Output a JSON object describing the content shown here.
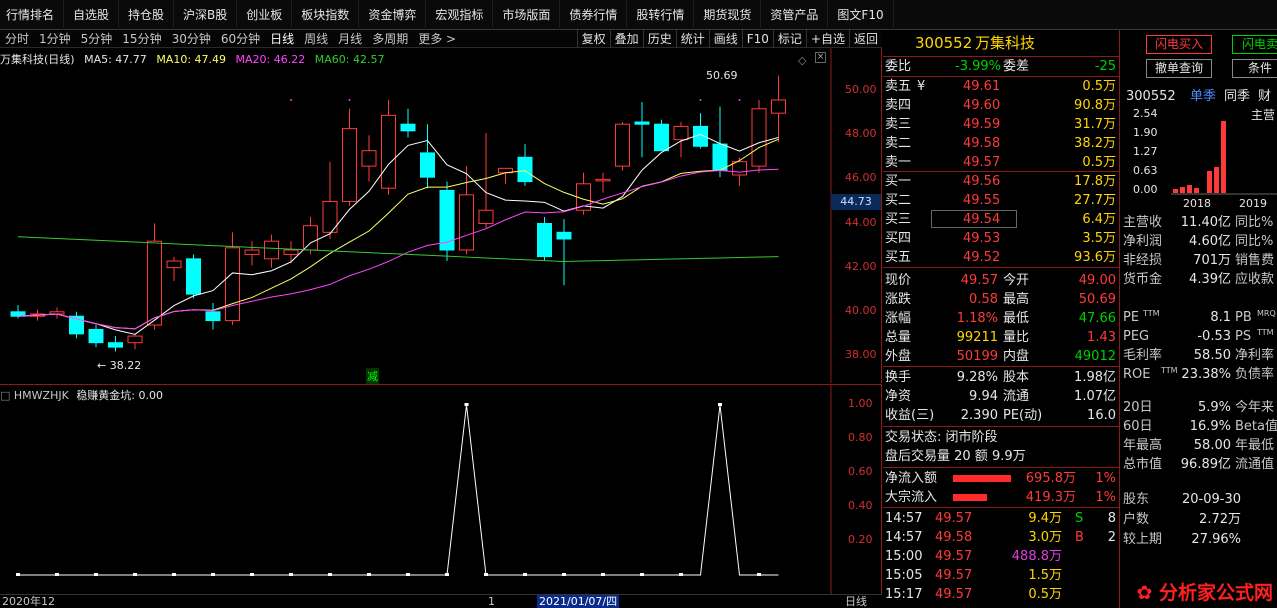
{
  "menu": [
    "行情排名",
    "自选股",
    "持仓股",
    "沪深B股",
    "创业板",
    "板块指数",
    "资金博弈",
    "宏观指标",
    "市场版面",
    "债券行情",
    "股转行情",
    "期货现货",
    "资管产品",
    "图文F10"
  ],
  "periods": [
    "分时",
    "1分钟",
    "5分钟",
    "15分钟",
    "30分钟",
    "60分钟",
    "日线",
    "周线",
    "月线",
    "多周期",
    "更多 >"
  ],
  "active_period": "日线",
  "tools": [
    "复权",
    "叠加",
    "历史",
    "统计",
    "画线",
    "F10",
    "标记",
    "+自选",
    "返回"
  ],
  "legend": {
    "title": "万集科技(日线)",
    "ma5": "MA5: 47.77",
    "ma10": "MA10: 47.49",
    "ma20": "MA20: 46.22",
    "ma60": "MA60: 42.57"
  },
  "colors": {
    "up": "#ff3a3a",
    "down": "#00ffff",
    "ma5": "#ffffff",
    "ma10": "#ffff66",
    "ma20": "#ff44ff",
    "ma60": "#33cc33"
  },
  "main_axis": [
    "50.00",
    "48.00",
    "46.00",
    "44.00",
    "42.00",
    "40.00",
    "38.00"
  ],
  "current_price_tag": "44.73",
  "high_label": "50.69",
  "low_label": "38.22",
  "reduce_marker": "减",
  "sub_legend": {
    "name": "HMWZHJK",
    "label": "稳赚黄金坑: 0.00"
  },
  "sub_axis": [
    "1.00",
    "0.80",
    "0.60",
    "0.40",
    "0.20"
  ],
  "time_axis": {
    "left": "2020年12",
    "mid_mark": "1",
    "cursor_date": "2021/01/07/四",
    "right": "日线"
  },
  "quote": {
    "code": "300552",
    "name": "万集科技",
    "weibi_label": "委比",
    "weibi_value": "-3.99%",
    "weicha_label": "委差",
    "weicha_value": "-25",
    "asks": [
      {
        "label": "卖五",
        "price": "49.61",
        "vol": "0.5万",
        "mark": "¥"
      },
      {
        "label": "卖四",
        "price": "49.60",
        "vol": "90.8万",
        "mark": ""
      },
      {
        "label": "卖三",
        "price": "49.59",
        "vol": "31.7万",
        "mark": ""
      },
      {
        "label": "卖二",
        "price": "49.58",
        "vol": "38.2万",
        "mark": ""
      },
      {
        "label": "卖一",
        "price": "49.57",
        "vol": "0.5万",
        "mark": ""
      }
    ],
    "bids": [
      {
        "label": "买一",
        "price": "49.56",
        "vol": "17.8万"
      },
      {
        "label": "买二",
        "price": "49.55",
        "vol": "27.7万"
      },
      {
        "label": "买三",
        "price": "49.54",
        "vol": "6.4万"
      },
      {
        "label": "买四",
        "price": "49.53",
        "vol": "3.5万"
      },
      {
        "label": "买五",
        "price": "49.52",
        "vol": "93.6万"
      }
    ],
    "stats": [
      {
        "l1": "现价",
        "v1": "49.57",
        "c1": "red",
        "l2": "今开",
        "v2": "49.00",
        "c2": "red"
      },
      {
        "l1": "涨跌",
        "v1": "0.58",
        "c1": "red",
        "l2": "最高",
        "v2": "50.69",
        "c2": "red"
      },
      {
        "l1": "涨幅",
        "v1": "1.18%",
        "c1": "red",
        "l2": "最低",
        "v2": "47.66",
        "c2": "green"
      },
      {
        "l1": "总量",
        "v1": "99211",
        "c1": "yellow",
        "l2": "量比",
        "v2": "1.43",
        "c2": "red"
      },
      {
        "l1": "外盘",
        "v1": "50199",
        "c1": "red",
        "l2": "内盘",
        "v2": "49012",
        "c2": "green"
      }
    ],
    "stats2": [
      {
        "l1": "换手",
        "v1": "9.28%",
        "l2": "股本",
        "v2": "1.98亿"
      },
      {
        "l1": "净资",
        "v1": "9.94",
        "l2": "流通",
        "v2": "1.07亿"
      },
      {
        "l1": "收益(三)",
        "v1": "2.390",
        "l2": "PE(动)",
        "v2": "16.0"
      }
    ],
    "trade_status": "交易状态: 闭市阶段",
    "after_hours": "盘后交易量 20 额 9.9万",
    "flows": [
      {
        "label": "净流入额",
        "value": "695.8万",
        "pct": "1%"
      },
      {
        "label": "大宗流入",
        "value": "419.3万",
        "pct": "1%"
      }
    ],
    "ticks": [
      {
        "time": "14:57",
        "price": "49.57",
        "vol": "9.4万",
        "side": "S",
        "n": "8"
      },
      {
        "time": "14:57",
        "price": "49.58",
        "vol": "3.0万",
        "side": "B",
        "n": "2"
      },
      {
        "time": "15:00",
        "price": "49.57",
        "vol": "488.8万",
        "side": "",
        "n": ""
      },
      {
        "time": "15:05",
        "price": "49.57",
        "vol": "1.5万",
        "side": "",
        "n": ""
      },
      {
        "time": "15:17",
        "price": "49.57",
        "vol": "0.5万",
        "side": "",
        "n": ""
      }
    ]
  },
  "right": {
    "buy_button": "闪电买入",
    "sell_button": "闪电卖",
    "cancel_button": "撤单查询",
    "cond_button": "条件",
    "code": "300552",
    "tabs": [
      "单季",
      "同季",
      "财"
    ],
    "chart_axis": [
      "2.54",
      "1.90",
      "1.27",
      "0.63",
      "0.00"
    ],
    "chart_years": [
      "2018",
      "2019"
    ],
    "chart_title": "主营",
    "fin": [
      {
        "l1": "主营收",
        "v1": "11.40亿",
        "l2": "同比%"
      },
      {
        "l1": "净利润",
        "v1": "4.60亿",
        "l2": "同比%"
      },
      {
        "l1": "非经损",
        "v1": "701万",
        "l2": "销售费"
      },
      {
        "l1": "货币金",
        "v1": "4.39亿",
        "l2": "应收款"
      }
    ],
    "val": [
      {
        "l1": "PE",
        "sup1": "TTM",
        "v1": "8.1",
        "l2": "PB",
        "sup2": "MRQ"
      },
      {
        "l1": "PEG",
        "sup1": "",
        "v1": "-0.53",
        "l2": "PS",
        "sup2": "TTM"
      },
      {
        "l1": "毛利率",
        "sup1": "",
        "v1": "58.50",
        "l2": "净利率",
        "sup2": ""
      },
      {
        "l1": "ROE",
        "sup1": "TTM",
        "v1": "23.38%",
        "l2": "负债率",
        "sup2": ""
      }
    ],
    "perf": [
      {
        "l1": "20日",
        "v1": "5.9%",
        "l2": "今年来"
      },
      {
        "l1": "60日",
        "v1": "16.9%",
        "l2": "Beta值"
      },
      {
        "l1": "年最高",
        "v1": "58.00",
        "l2": "年最低"
      },
      {
        "l1": "总市值",
        "v1": "96.89亿",
        "l2": "流通值"
      }
    ],
    "holders": [
      {
        "l": "股东",
        "v": "20-09-30"
      },
      {
        "l": "户数",
        "v": "2.72万"
      },
      {
        "l": "较上期",
        "v": "27.96%"
      }
    ]
  },
  "chart_data": {
    "type": "candlestick",
    "candles": [
      {
        "o": 40.0,
        "h": 40.3,
        "l": 39.7,
        "c": 39.8
      },
      {
        "o": 39.8,
        "h": 40.1,
        "l": 39.6,
        "c": 39.9
      },
      {
        "o": 39.9,
        "h": 40.2,
        "l": 39.7,
        "c": 40.0
      },
      {
        "o": 39.8,
        "h": 40.0,
        "l": 38.8,
        "c": 39.0
      },
      {
        "o": 39.2,
        "h": 39.4,
        "l": 38.4,
        "c": 38.6
      },
      {
        "o": 38.6,
        "h": 38.9,
        "l": 38.2,
        "c": 38.4
      },
      {
        "o": 38.6,
        "h": 39.0,
        "l": 38.3,
        "c": 38.9
      },
      {
        "o": 39.4,
        "h": 44.0,
        "l": 39.2,
        "c": 43.2
      },
      {
        "o": 42.0,
        "h": 42.5,
        "l": 41.4,
        "c": 42.3
      },
      {
        "o": 42.4,
        "h": 42.6,
        "l": 40.6,
        "c": 40.8
      },
      {
        "o": 40.0,
        "h": 40.4,
        "l": 39.2,
        "c": 39.6
      },
      {
        "o": 39.6,
        "h": 43.6,
        "l": 39.4,
        "c": 42.9
      },
      {
        "o": 42.6,
        "h": 43.2,
        "l": 42.1,
        "c": 42.8
      },
      {
        "o": 42.4,
        "h": 43.5,
        "l": 42.0,
        "c": 43.2
      },
      {
        "o": 42.6,
        "h": 43.2,
        "l": 42.2,
        "c": 42.8
      },
      {
        "o": 42.8,
        "h": 44.3,
        "l": 42.6,
        "c": 43.9
      },
      {
        "o": 43.6,
        "h": 46.8,
        "l": 43.3,
        "c": 45.0
      },
      {
        "o": 45.0,
        "h": 49.2,
        "l": 44.8,
        "c": 48.3
      },
      {
        "o": 46.6,
        "h": 48.0,
        "l": 45.9,
        "c": 47.3
      },
      {
        "o": 45.6,
        "h": 49.6,
        "l": 45.3,
        "c": 48.9
      },
      {
        "o": 48.5,
        "h": 49.2,
        "l": 47.9,
        "c": 48.2
      },
      {
        "o": 47.2,
        "h": 48.5,
        "l": 45.6,
        "c": 46.1
      },
      {
        "o": 45.5,
        "h": 45.9,
        "l": 42.3,
        "c": 42.8
      },
      {
        "o": 42.8,
        "h": 46.6,
        "l": 42.6,
        "c": 45.3
      },
      {
        "o": 44.0,
        "h": 48.1,
        "l": 43.8,
        "c": 44.6
      },
      {
        "o": 46.3,
        "h": 46.5,
        "l": 45.8,
        "c": 46.5
      },
      {
        "o": 47.0,
        "h": 47.6,
        "l": 45.7,
        "c": 45.9
      },
      {
        "o": 44.0,
        "h": 44.3,
        "l": 42.3,
        "c": 42.5
      },
      {
        "o": 43.6,
        "h": 44.2,
        "l": 41.2,
        "c": 43.3
      },
      {
        "o": 44.6,
        "h": 46.3,
        "l": 44.4,
        "c": 45.8
      },
      {
        "o": 46.0,
        "h": 46.3,
        "l": 45.4,
        "c": 46.0
      },
      {
        "o": 46.6,
        "h": 48.6,
        "l": 46.4,
        "c": 48.5
      },
      {
        "o": 48.6,
        "h": 49.5,
        "l": 47.0,
        "c": 48.5
      },
      {
        "o": 48.5,
        "h": 48.7,
        "l": 47.5,
        "c": 47.3
      },
      {
        "o": 47.8,
        "h": 48.6,
        "l": 47.0,
        "c": 48.4
      },
      {
        "o": 48.4,
        "h": 49.0,
        "l": 47.4,
        "c": 47.5
      },
      {
        "o": 47.6,
        "h": 49.3,
        "l": 46.1,
        "c": 46.4
      },
      {
        "o": 46.2,
        "h": 47.0,
        "l": 45.7,
        "c": 46.8
      },
      {
        "o": 46.6,
        "h": 49.6,
        "l": 46.3,
        "c": 49.2
      },
      {
        "o": 49.0,
        "h": 50.7,
        "l": 47.7,
        "c": 49.6
      }
    ],
    "indicator": [
      0,
      0,
      0,
      0,
      0,
      0,
      0,
      0,
      0,
      0,
      0,
      0,
      0,
      0,
      0,
      0,
      0,
      0,
      0,
      0,
      0,
      0,
      0,
      1,
      0,
      0,
      0,
      0,
      0,
      0,
      0,
      0,
      0,
      0,
      0,
      0,
      1,
      0,
      0,
      0
    ]
  }
}
